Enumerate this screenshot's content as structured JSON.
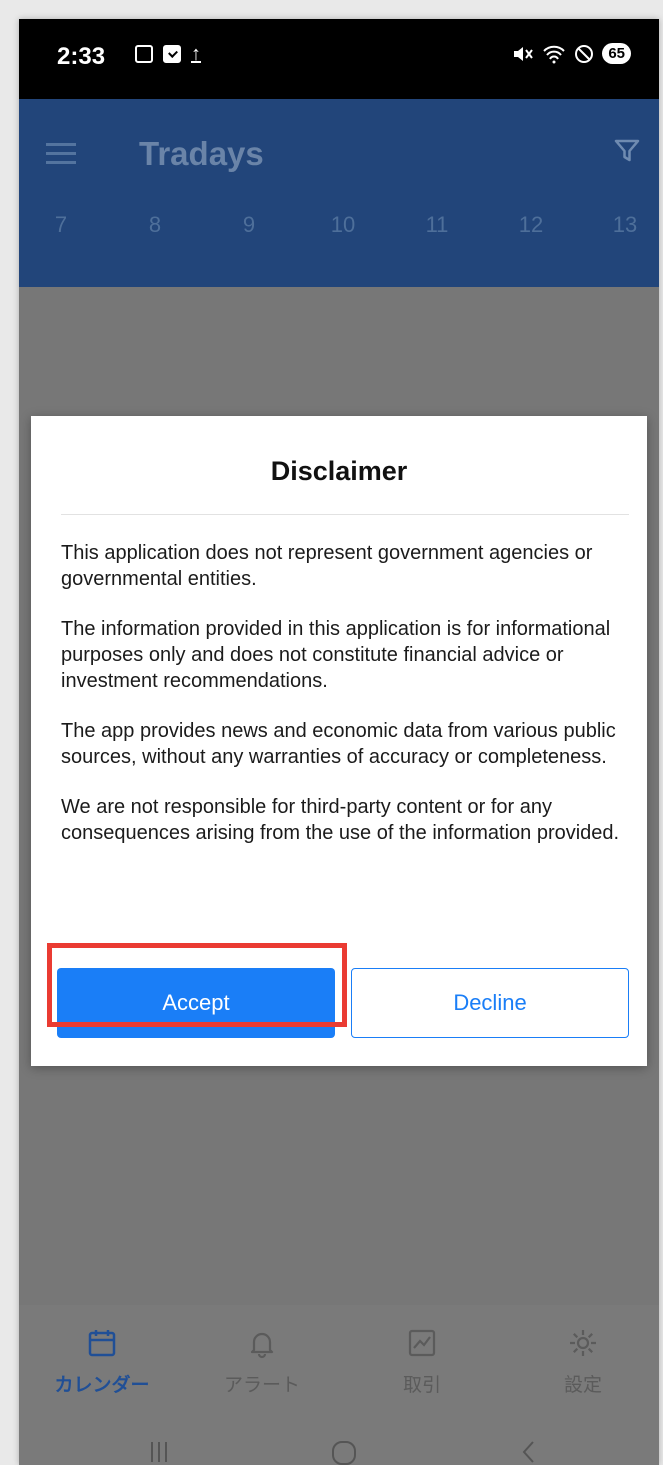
{
  "status_bar": {
    "time": "2:33",
    "battery": "65"
  },
  "app_bar": {
    "title": "Tradays",
    "days": [
      "7",
      "8",
      "9",
      "10",
      "11",
      "12",
      "13"
    ]
  },
  "dialog": {
    "title": "Disclaimer",
    "paragraphs": [
      "This application does not represent government agencies or governmental entities.",
      "The information provided in this application is for informational purposes only and does not constitute financial advice or investment recommendations.",
      "The app provides news and economic data from various public sources, without any warranties of accuracy or completeness.",
      "We are not responsible for third-party content or for any consequences arising from the use of the information provided."
    ],
    "accept_label": "Accept",
    "decline_label": "Decline"
  },
  "bottom_nav": {
    "items": [
      {
        "label": "カレンダー",
        "icon": "calendar-icon"
      },
      {
        "label": "アラート",
        "icon": "bell-icon"
      },
      {
        "label": "取引",
        "icon": "chart-icon"
      },
      {
        "label": "設定",
        "icon": "gear-icon"
      }
    ]
  },
  "colors": {
    "accent": "#1a7ef7",
    "highlight": "#ea3b32",
    "app_bar": "#22457a"
  }
}
